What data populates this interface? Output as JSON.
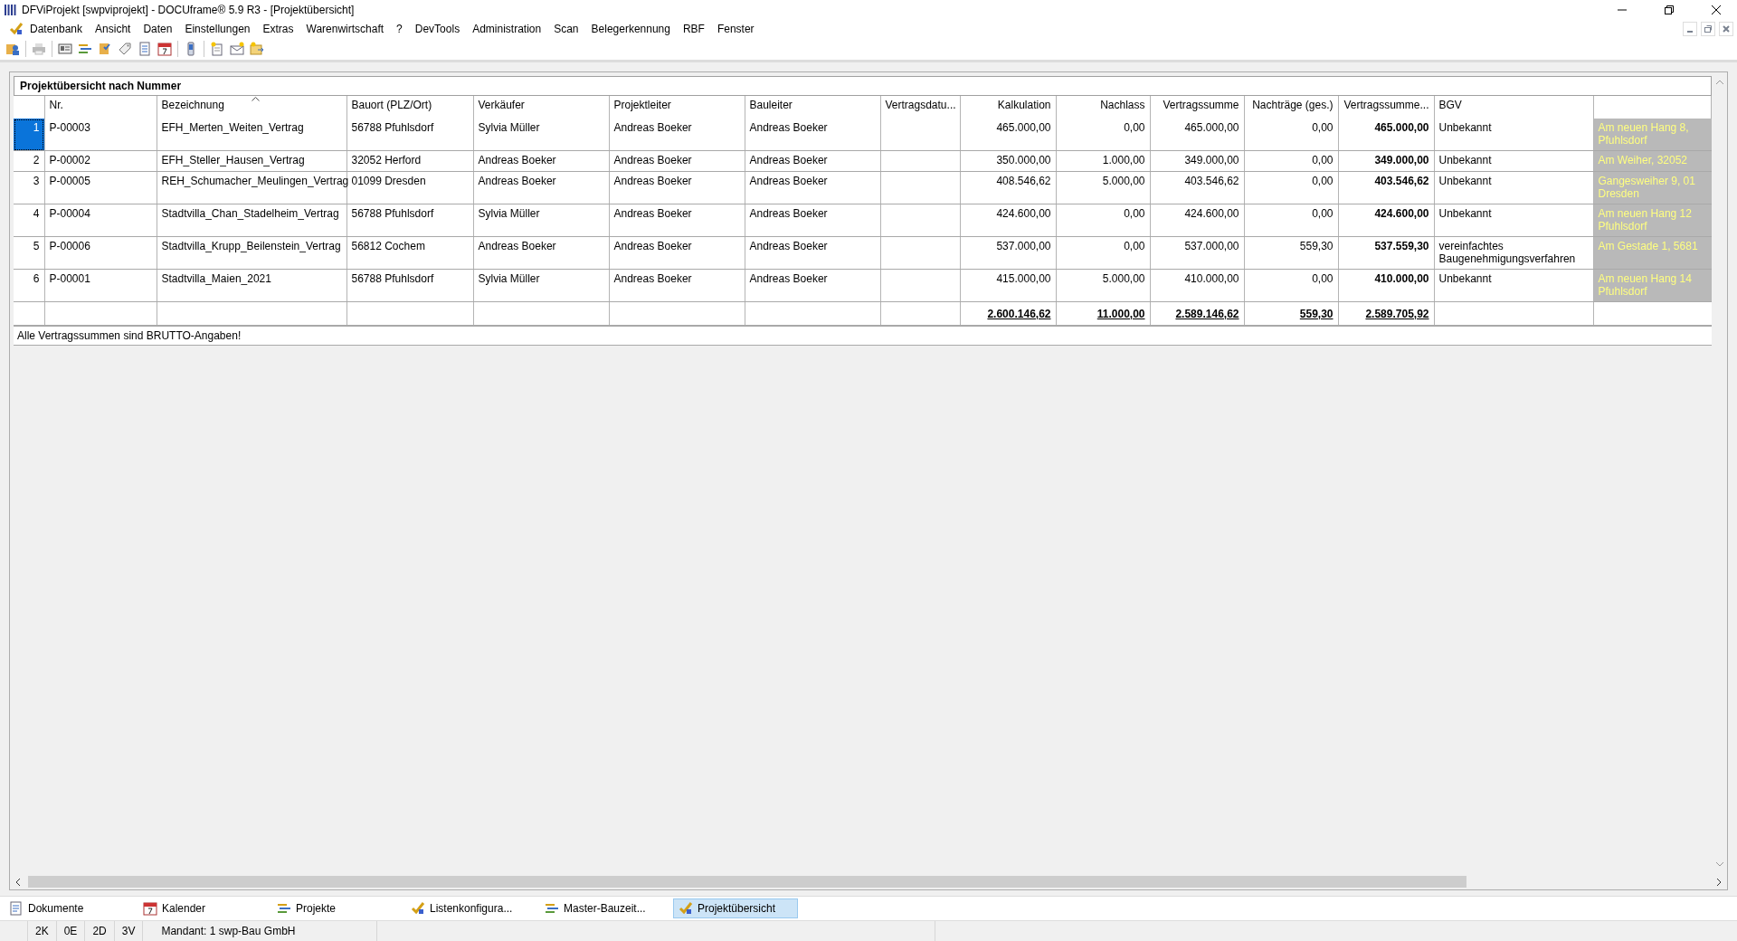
{
  "window": {
    "title": "DFViProjekt [swpviprojekt] - DOCUframe® 5.9 R3 - [Projektübersicht]"
  },
  "menu": [
    "Datenbank",
    "Ansicht",
    "Daten",
    "Einstellungen",
    "Extras",
    "Warenwirtschaft",
    "?",
    "DevTools",
    "Administration",
    "Scan",
    "Belegerkennung",
    "RBF",
    "Fenster"
  ],
  "panel": {
    "title": "Projektübersicht nach Nummer"
  },
  "table": {
    "columns": [
      {
        "label": "Nr.",
        "kind": "text",
        "sorted": false
      },
      {
        "label": "Bezeichnung",
        "kind": "text",
        "sorted": true
      },
      {
        "label": "Bauort (PLZ/Ort)",
        "kind": "text",
        "sorted": false
      },
      {
        "label": "Verkäufer",
        "kind": "text",
        "sorted": false
      },
      {
        "label": "Projektleiter",
        "kind": "text",
        "sorted": false
      },
      {
        "label": "Bauleiter",
        "kind": "text",
        "sorted": false
      },
      {
        "label": "Vertragsdatu...",
        "kind": "text",
        "sorted": false
      },
      {
        "label": "Kalkulation",
        "kind": "number",
        "sorted": false,
        "total": "2.600.146,62"
      },
      {
        "label": "Nachlass",
        "kind": "number",
        "sorted": false,
        "total": "11.000,00"
      },
      {
        "label": "Vertragssumme",
        "kind": "number",
        "sorted": false,
        "total": "2.589.146,62"
      },
      {
        "label": "Nachträge (ges.)",
        "kind": "number",
        "sorted": false,
        "total": "559,30"
      },
      {
        "label": "Vertragssumme...",
        "kind": "bold_number",
        "sorted": false,
        "total": "2.589.705,92"
      },
      {
        "label": "BGV",
        "kind": "text",
        "sorted": false
      },
      {
        "kind": "highlight",
        "sorted": false
      }
    ],
    "rows": [
      {
        "index": "1",
        "selected": true,
        "cells": [
          "P-00003",
          "EFH_Merten_Weiten_Vertrag",
          "56788 Pfuhlsdorf",
          "Sylvia Müller",
          "Andreas Boeker",
          "Andreas Boeker",
          null,
          "465.000,00",
          "0,00",
          "465.000,00",
          "0,00",
          "465.000,00",
          "Unbekannt",
          [
            "Am neuen Hang 8,",
            "Pfuhlsdorf"
          ]
        ]
      },
      {
        "index": "2",
        "selected": false,
        "cells": [
          "P-00002",
          "EFH_Steller_Hausen_Vertrag",
          "32052 Herford",
          "Andreas Boeker",
          "Andreas Boeker",
          "Andreas Boeker",
          null,
          "350.000,00",
          "1.000,00",
          "349.000,00",
          "0,00",
          "349.000,00",
          "Unbekannt",
          [
            "Am Weiher, 32052"
          ]
        ]
      },
      {
        "index": "3",
        "selected": false,
        "cells": [
          "P-00005",
          "REH_Schumacher_Meulingen_Vertrag",
          "01099 Dresden",
          "Andreas Boeker",
          "Andreas Boeker",
          "Andreas Boeker",
          null,
          "408.546,62",
          "5.000,00",
          "403.546,62",
          "0,00",
          "403.546,62",
          "Unbekannt",
          [
            "Gangesweiher 9, 01",
            "Dresden"
          ]
        ]
      },
      {
        "index": "4",
        "selected": false,
        "cells": [
          "P-00004",
          "Stadtvilla_Chan_Stadelheim_Vertrag",
          "56788 Pfuhlsdorf",
          "Sylvia Müller",
          "Andreas Boeker",
          "Andreas Boeker",
          null,
          "424.600,00",
          "0,00",
          "424.600,00",
          "0,00",
          "424.600,00",
          "Unbekannt",
          [
            "Am neuen Hang 12",
            "Pfuhlsdorf"
          ]
        ]
      },
      {
        "index": "5",
        "selected": false,
        "cells": [
          "P-00006",
          "Stadtvilla_Krupp_Beilenstein_Vertrag",
          "56812 Cochem",
          "Andreas Boeker",
          "Andreas Boeker",
          "Andreas Boeker",
          null,
          "537.000,00",
          "0,00",
          "537.000,00",
          "559,30",
          "537.559,30",
          "vereinfachtes Baugenehmigungsverfahren",
          [
            "Am Gestade 1, 5681"
          ]
        ]
      },
      {
        "index": "6",
        "selected": false,
        "cells": [
          "P-00001",
          "Stadtvilla_Maien_2021",
          "56788 Pfuhlsdorf",
          "Sylvia Müller",
          "Andreas Boeker",
          "Andreas Boeker",
          null,
          "415.000,00",
          "5.000,00",
          "410.000,00",
          "0,00",
          "410.000,00",
          "Unbekannt",
          [
            "Am neuen Hang 14",
            "Pfuhlsdorf"
          ]
        ]
      }
    ]
  },
  "note": "Alle Vertragssummen sind BRUTTO-Angaben!",
  "tabs": [
    {
      "label": "Dokumente",
      "selected": false
    },
    {
      "label": "Kalender",
      "selected": false
    },
    {
      "label": "Projekte",
      "selected": false
    },
    {
      "label": "Listenkonfigura...",
      "selected": false
    },
    {
      "label": "Master-Bauzeit...",
      "selected": false
    },
    {
      "label": "Projektübersicht",
      "selected": true
    }
  ],
  "status_bar": [
    "2K",
    "0E",
    "2D",
    "3V",
    "Mandant: 1 swp-Bau GmbH"
  ]
}
